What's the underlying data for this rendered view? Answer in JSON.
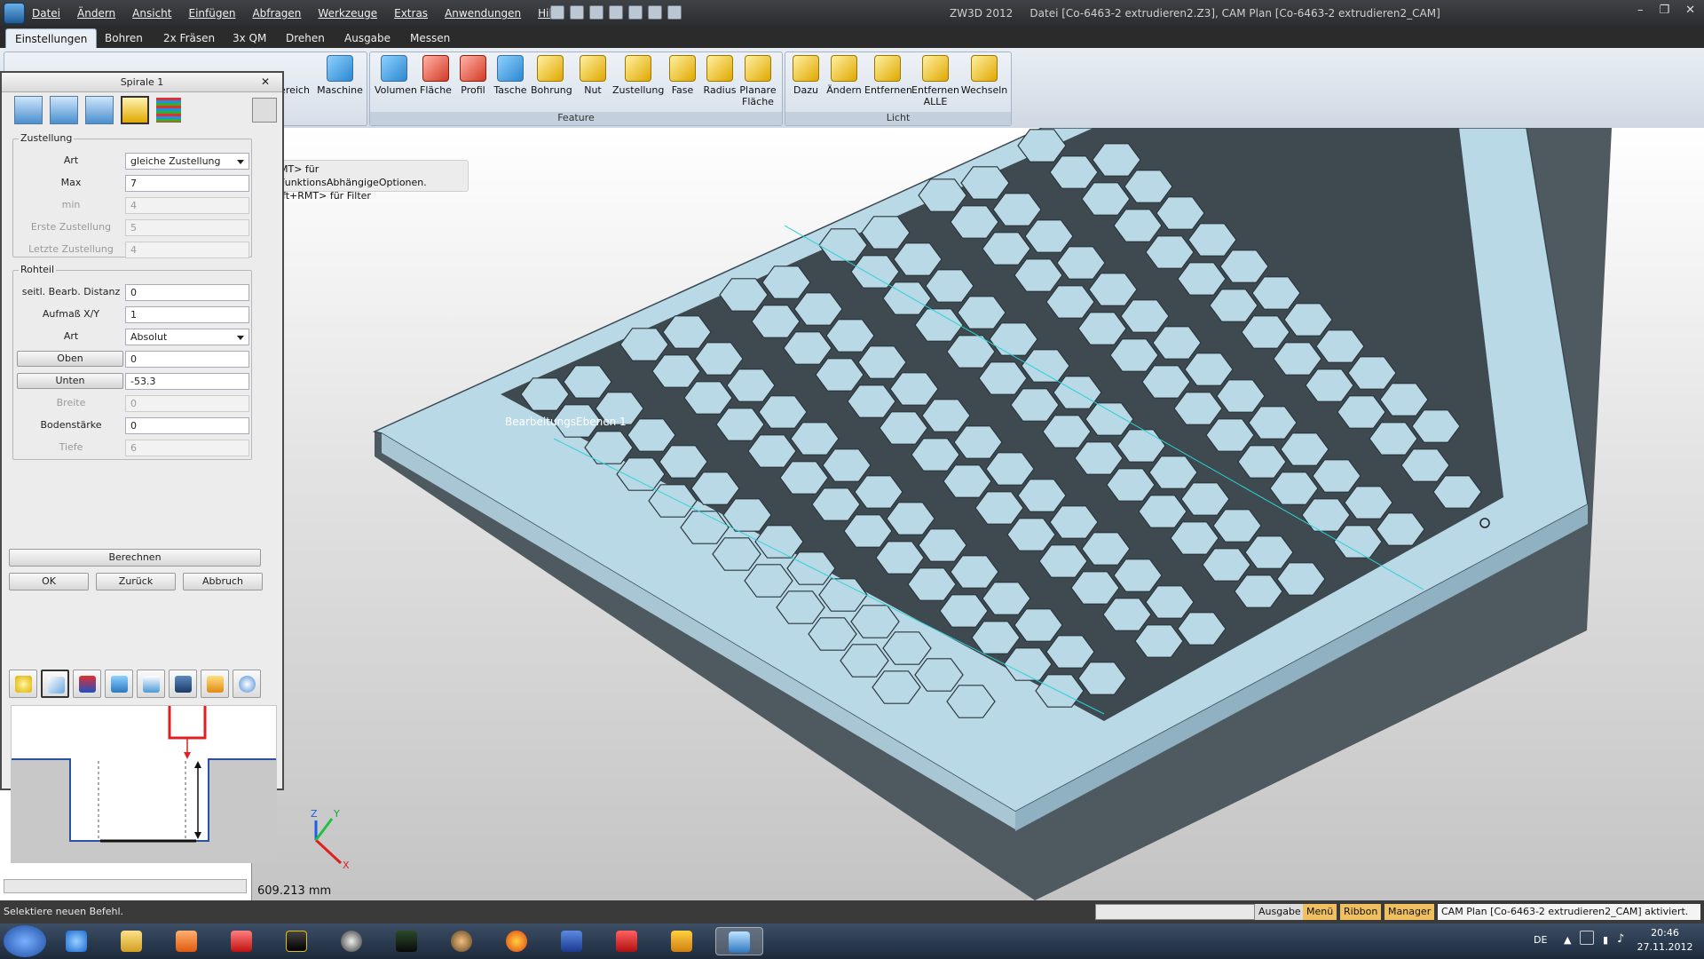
{
  "titlebar": {
    "menu": [
      "Datei",
      "Ändern",
      "Ansicht",
      "Einfügen",
      "Abfragen",
      "Werkzeuge",
      "Extras",
      "Anwendungen",
      "Hilfe"
    ],
    "app_name": "ZW3D 2012",
    "doc_title": "Datei [Co-6463-2 extrudieren2.Z3],  CAM Plan [Co-6463-2 extrudieren2_CAM]"
  },
  "tabs": [
    "Einstellungen",
    "Bohren",
    "2x Fräsen",
    "3x QM",
    "Drehen",
    "Ausgabe",
    "Messen"
  ],
  "ribbon": {
    "partial_labels": [
      "ereich",
      "Maschine"
    ],
    "feature_buttons": [
      "Volumen",
      "Fläche",
      "Profil",
      "Tasche",
      "Bohrung",
      "Nut",
      "Zustellung",
      "Fase",
      "Radius",
      "Planare Fläche"
    ],
    "feature_group": "Feature",
    "licht_buttons": [
      "Dazu",
      "Ändern",
      "Entfernen",
      "Entfernen ALLE",
      "Wechseln"
    ],
    "licht_group": "Licht"
  },
  "dialog": {
    "title": "Spirale 1",
    "zustellung": {
      "legend": "Zustellung",
      "rows": [
        {
          "label": "Art",
          "value": "gleiche Zustellung"
        },
        {
          "label": "Max",
          "value": "7"
        },
        {
          "label": "min",
          "value": "4"
        },
        {
          "label": "Erste Zustellung",
          "value": "5"
        },
        {
          "label": "Letzte Zustellung",
          "value": "4"
        }
      ]
    },
    "rohteil": {
      "legend": "Rohteil",
      "rows": [
        {
          "label": "seitl. Bearb. Distanz",
          "value": "0"
        },
        {
          "label": "Aufmaß X/Y",
          "value": "1"
        },
        {
          "label": "Art",
          "value": "Absolut"
        },
        {
          "label": "Oben",
          "value": "0"
        },
        {
          "label": "Unten",
          "value": "-53.3"
        },
        {
          "label": "Breite",
          "value": "0"
        },
        {
          "label": "Bodenstärke",
          "value": "0"
        },
        {
          "label": "Tiefe",
          "value": "6"
        }
      ]
    },
    "berechnen": "Berechnen",
    "ok": "OK",
    "zurueck": "Zurück",
    "abbruch": "Abbruch"
  },
  "viewport": {
    "hint_line1": "MT> für FunktionsAbhängigeOptionen.",
    "hint_line2": "ift+RMT> für Filter",
    "plane_label": "BearbeitungsEbenen 1",
    "measure": "609.213 mm",
    "axes": {
      "x": "X",
      "y": "Y",
      "z": "Z"
    }
  },
  "status": {
    "left": "Selektiere neuen Befehl.",
    "tabs": [
      "Ausgabe",
      "Menü",
      "Ribbon",
      "Manager"
    ],
    "message": "CAM Plan [Co-6463-2 extrudieren2_CAM] aktiviert."
  },
  "taskbar": {
    "lang": "DE",
    "time": "20:46",
    "date": "27.11.2012"
  },
  "colors": {
    "part_face": "#b9d9e7",
    "accent_orange": "#e8a020",
    "status_tab_orange": "#f0c060"
  }
}
